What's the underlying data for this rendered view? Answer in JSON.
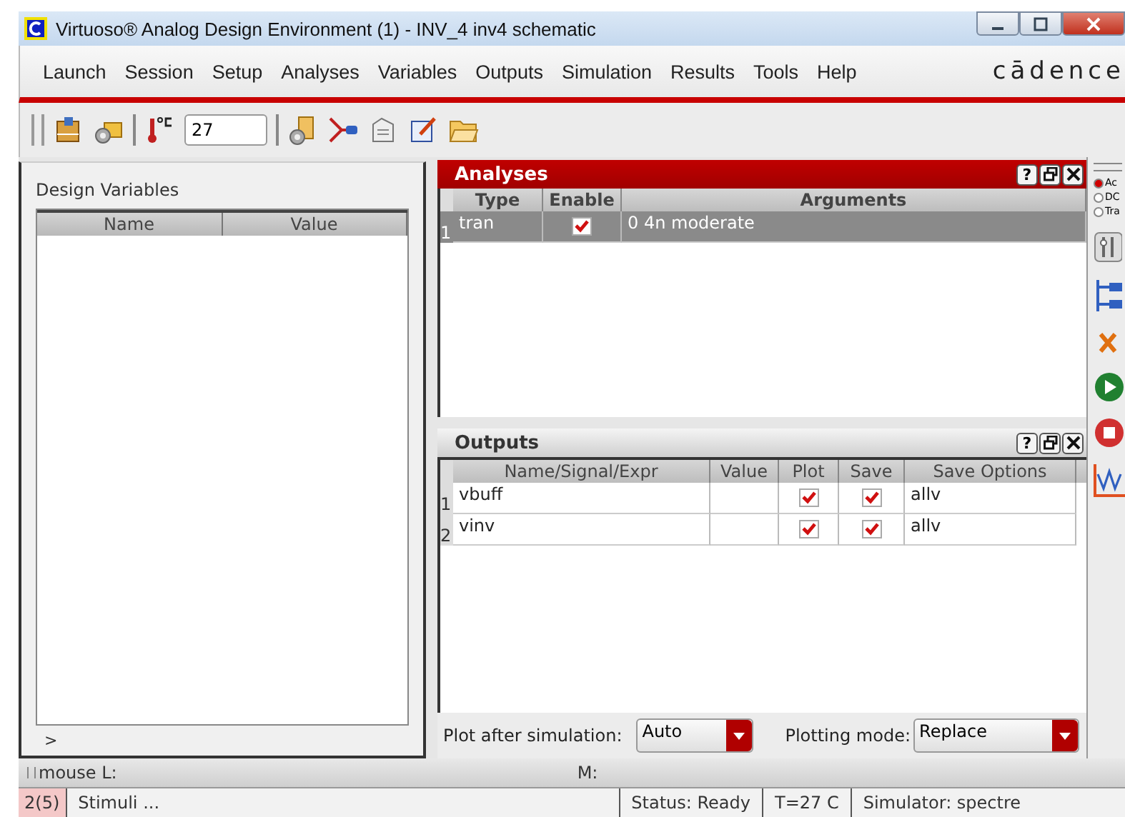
{
  "window": {
    "title": "Virtuoso® Analog Design Environment (1) - INV_4 inv4 schematic"
  },
  "menu": [
    "Launch",
    "Session",
    "Setup",
    "Analyses",
    "Variables",
    "Outputs",
    "Simulation",
    "Results",
    "Tools",
    "Help"
  ],
  "logo": "cādence",
  "toolbar": {
    "temperature": "27"
  },
  "design_variables": {
    "title": "Design Variables",
    "columns": [
      "Name",
      "Value"
    ],
    "footer": ">"
  },
  "analyses": {
    "title": "Analyses",
    "help": "?",
    "columns": [
      "Type",
      "Enable",
      "Arguments"
    ],
    "rows": [
      {
        "index": "1",
        "type": "tran",
        "enabled": true,
        "arguments": "0 4n moderate",
        "selected": true
      }
    ]
  },
  "outputs": {
    "title": "Outputs",
    "help": "?",
    "columns": [
      "Name/Signal/Expr",
      "Value",
      "Plot",
      "Save",
      "Save Options"
    ],
    "rows": [
      {
        "index": "1",
        "name": "vbuff",
        "plot": true,
        "save": true,
        "options": "allv",
        "selected": false
      },
      {
        "index": "2",
        "name": "vinv",
        "plot": true,
        "save": true,
        "options": "allv",
        "selected": false
      }
    ],
    "plot_after": {
      "label": "Plot after simulation:",
      "value": "Auto"
    },
    "plotting_mode": {
      "label": "Plotting mode:",
      "value": "Replace"
    }
  },
  "side_radios": [
    {
      "label": "Ac",
      "selected": true
    },
    {
      "label": "DC",
      "selected": false
    },
    {
      "label": "Tra",
      "selected": false
    }
  ],
  "mouse_bar": {
    "left": "mouse L:",
    "middle": "M:"
  },
  "status_bar": {
    "count": "2(5)",
    "message": "Stimuli ...",
    "status": "Status: Ready",
    "temperature": "T=27   C",
    "simulator": "Simulator: spectre"
  }
}
